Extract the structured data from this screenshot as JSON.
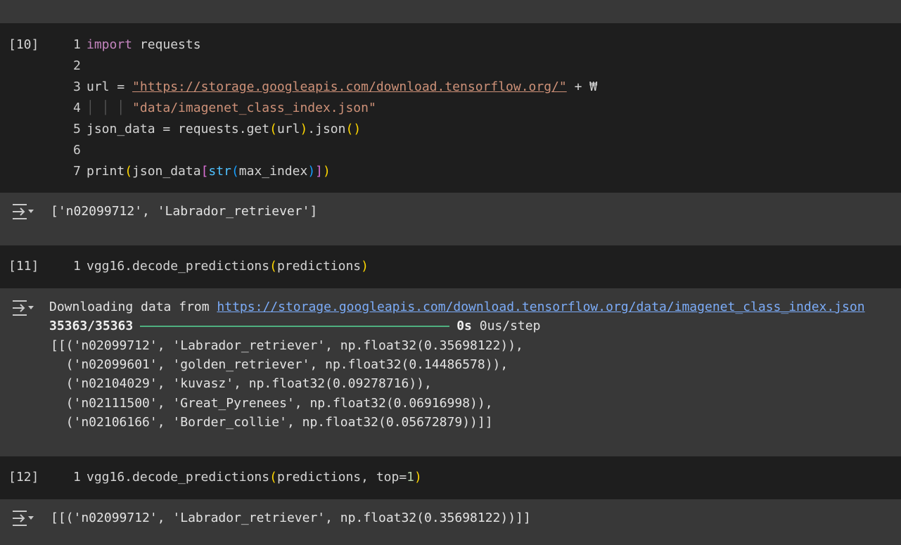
{
  "cells": [
    {
      "exec_count": "[10]",
      "line_numbers": [
        "1",
        "2",
        "3",
        "4",
        "5",
        "6",
        "7"
      ],
      "code": {
        "l1_kw": "import",
        "l1_rest": " requests",
        "l3_prefix": "url = ",
        "l3_url": "\"https://storage.googleapis.com/download.tensorflow.org/\"",
        "l3_suffix": " + ₩",
        "l4_guides": "│ │ │ ",
        "l4_str": "\"data/imagenet_class_index.json\"",
        "l5_prefix": "json_data = requests.get",
        "l5_open": "(",
        "l5_arg": "url",
        "l5_close": ")",
        "l5_json": ".json",
        "l5_call": "()",
        "l7_print": "print",
        "l7_open": "(",
        "l7_var": "json_data",
        "l7_lbr": "[",
        "l7_str": "str",
        "l7_open2": "(",
        "l7_arg": "max_index",
        "l7_close2": ")",
        "l7_rbr": "]",
        "l7_close": ")"
      },
      "output": "['n02099712', 'Labrador_retriever']"
    },
    {
      "exec_count": "[11]",
      "line_numbers": [
        "1"
      ],
      "code": {
        "call": "vgg16.decode_predictions",
        "open": "(",
        "arg": "predictions",
        "close": ")"
      },
      "output": {
        "download_prefix": "Downloading data from ",
        "download_url": "https://storage.googleapis.com/download.tensorflow.org/data/imagenet_class_index.json",
        "progress_count": "35363/35363",
        "progress_fraction": 1.0,
        "progress_time": "0s",
        "progress_rate": " 0us/step",
        "lines": [
          "[[('n02099712', 'Labrador_retriever', np.float32(0.35698122)),",
          "  ('n02099601', 'golden_retriever', np.float32(0.14486578)),",
          "  ('n02104029', 'kuvasz', np.float32(0.09278716)),",
          "  ('n02111500', 'Great_Pyrenees', np.float32(0.06916998)),",
          "  ('n02106166', 'Border_collie', np.float32(0.05672879))]]"
        ]
      }
    },
    {
      "exec_count": "[12]",
      "line_numbers": [
        "1"
      ],
      "code": {
        "call": "vgg16.decode_predictions",
        "open": "(",
        "arg": "predictions, top=",
        "num": "1",
        "close": ")"
      },
      "output": "[[('n02099712', 'Labrador_retriever', np.float32(0.35698122))]]"
    }
  ],
  "icons": {
    "output_toggle": "output-collapse-icon"
  },
  "colors": {
    "code_bg": "#1e1e1e",
    "output_bg": "#383838",
    "progress": "#4fb07f",
    "link": "#7cacf8"
  }
}
